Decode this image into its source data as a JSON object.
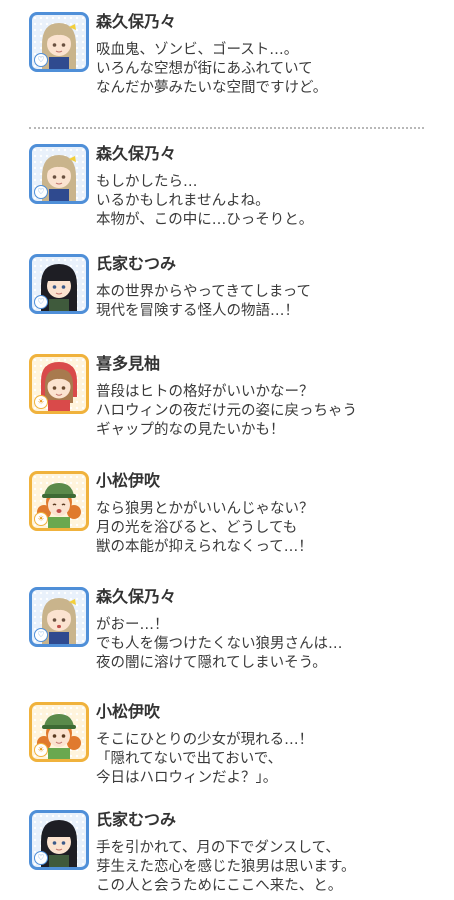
{
  "log": {
    "messages": [
      {
        "speaker": "森久保乃々",
        "avatar_icon": "morikubo-nono-portrait-icon",
        "attribute_color": "#4f8fd8",
        "lines": [
          "吸血鬼、ゾンビ、ゴースト…。",
          "いろんな空想が街にあふれていて",
          "なんだか夢みたいな空間ですけど。"
        ]
      },
      {
        "speaker": "森久保乃々",
        "avatar_icon": "morikubo-nono-portrait-icon",
        "attribute_color": "#4f8fd8",
        "lines": [
          "もしかしたら…",
          "いるかもしれませんよね。",
          "本物が、この中に…ひっそりと。"
        ]
      },
      {
        "speaker": "氏家むつみ",
        "avatar_icon": "ujiie-mutsumi-portrait-icon",
        "attribute_color": "#4f8fd8",
        "lines": [
          "本の世界からやってきてしまって",
          "現代を冒険する怪人の物語…！"
        ]
      },
      {
        "speaker": "喜多見柚",
        "avatar_icon": "kitami-yuzu-portrait-icon",
        "attribute_color": "#f0b23c",
        "lines": [
          "普段はヒトの格好がいいかなー？",
          "ハロウィンの夜だけ元の姿に戻っちゃう",
          "ギャップ的なの見たいかも！"
        ]
      },
      {
        "speaker": "小松伊吹",
        "avatar_icon": "komatsu-ibuki-portrait-icon",
        "attribute_color": "#f0b23c",
        "lines": [
          "なら狼男とかがいいんじゃない？",
          "月の光を浴びると、どうしても",
          "獣の本能が抑えられなくって…！"
        ]
      },
      {
        "speaker": "森久保乃々",
        "avatar_icon": "morikubo-nono-portrait-icon",
        "attribute_color": "#4f8fd8",
        "lines": [
          "がおー…！",
          "でも人を傷つけたくない狼男さんは…",
          "夜の闇に溶けて隠れてしまいそう。"
        ]
      },
      {
        "speaker": "小松伊吹",
        "avatar_icon": "komatsu-ibuki-portrait-icon",
        "attribute_color": "#f0b23c",
        "lines": [
          "そこにひとりの少女が現れる…！",
          "「隠れてないで出ておいで、",
          "今日はハロウィンだよ？」。"
        ]
      },
      {
        "speaker": "氏家むつみ",
        "avatar_icon": "ujiie-mutsumi-portrait-icon",
        "attribute_color": "#4f8fd8",
        "lines": [
          "手を引かれて、月の下でダンスして、",
          "芽生えた恋心を感じた狼男は思います。",
          "この人と会うためにここへ来た、と。"
        ]
      }
    ]
  }
}
